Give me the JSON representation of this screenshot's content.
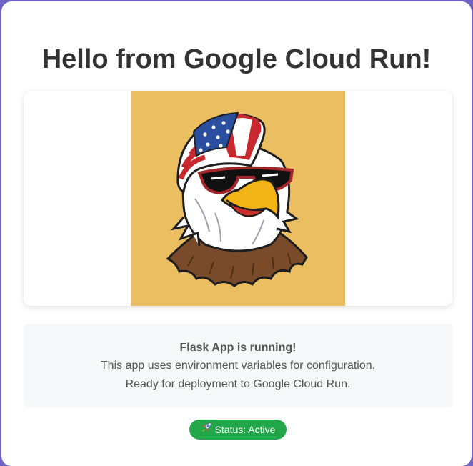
{
  "page": {
    "title": "Hello from Google Cloud Run!"
  },
  "image": {
    "subject": "eagle-mascot",
    "background_color": "#ecbe62"
  },
  "info": {
    "heading": "Flask App is running!",
    "line1": "This app uses environment variables for configuration.",
    "line2": "Ready for deployment to Google Cloud Run."
  },
  "status": {
    "icon": "rocket-icon",
    "label": "Status: Active",
    "color": "#22a84a"
  },
  "colors": {
    "title_text": "#333333",
    "body_text": "#555555",
    "info_background": "#f7f8fa",
    "frame_border": "#6f63c4"
  }
}
